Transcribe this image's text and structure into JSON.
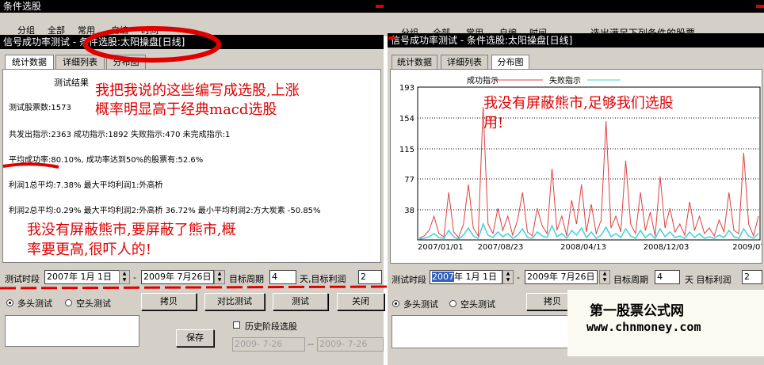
{
  "back_window": {
    "title": "条件选股",
    "tabs": [
      "分组",
      "全部",
      "常用",
      "自编",
      "时间"
    ],
    "caption": "选出满足下列条件的股票"
  },
  "left_window": {
    "title": "信号成功率测试 - 条件选股:太阳操盘[日线]",
    "tabs": [
      "统计数据",
      "详细列表",
      "分布图"
    ],
    "active_tab": 0,
    "heading": "测试结果",
    "lines": [
      "测试股票数:1573",
      "共发出指示:2363 成功指示:1892 失败指示:470 未完成指示:1",
      "平均成功率:80.10%, 成功率达到50%的股票有:52.6%",
      "利润1总平均:7.38% 最大平均利润1:外高桥",
      "利润2总平均:0.29% 最大平均利润2:外高桥     36.72% 最小平均利润2:方大炭素 -50.85%"
    ],
    "annotations": [
      "我把我说的这些编写成选股,上涨",
      "概率明显高于经典macd选股",
      "我没有屏蔽熊市,要屏蔽了熊市,概",
      "率要更高,很吓人的!"
    ],
    "controls": {
      "period_label": "测试时段",
      "start_date": "2007年 1月 1日",
      "dash": "-",
      "end_date": "2009年 7月26日",
      "target_period_label": "目标周期",
      "target_period": "4",
      "days_label": "天,目标利润",
      "target_profit": "2",
      "radio_long": "多头测试",
      "radio_short": "空头测试",
      "buttons": [
        "拷贝",
        "对比测试",
        "测试",
        "关闭"
      ],
      "history_label": "历史阶段选股",
      "save": "保存",
      "hist_start": "2009- 7-26",
      "hist_end": "2009- 7-26"
    }
  },
  "right_window": {
    "title": "信号成功率测试 - 条件选股:太阳操盘[日线]",
    "tabs": [
      "统计数据",
      "详细列表",
      "分布图"
    ],
    "active_tab": 2,
    "annotations": [
      "我没有屏蔽熊市,足够我们选股",
      "用!"
    ],
    "controls": {
      "period_label": "测试时段",
      "start_date_year": "2007",
      "start_date_rest": "年 1月 1日",
      "dash": "-",
      "end_date": "2009年 7月26日",
      "target_period_label": "目标周期",
      "target_period": "4",
      "days_label": "天 目标利润",
      "target_profit": "2",
      "radio_long": "多头测试",
      "radio_short": "空头测试",
      "copy": "拷贝"
    }
  },
  "watermark": {
    "name": "第一股票公式网",
    "url": "www.chnmoney.com"
  },
  "chart_data": {
    "type": "line",
    "legend": [
      "成功指示",
      "失败指示"
    ],
    "legend_placement": "top",
    "yticks": [
      193,
      154,
      115,
      77,
      38
    ],
    "ylim": [
      0,
      193
    ],
    "xticks": [
      "2007/01/01",
      "2007/08/23",
      "2008/04/13",
      "2008/12/03",
      "2009/07"
    ],
    "grid": true,
    "colors": {
      "success": "#e04040",
      "fail": "#40d0e0"
    },
    "series": [
      {
        "name": "成功指示",
        "values": [
          2,
          5,
          12,
          30,
          8,
          4,
          60,
          10,
          3,
          20,
          70,
          15,
          5,
          168,
          20,
          8,
          40,
          12,
          30,
          6,
          25,
          60,
          10,
          5,
          40,
          18,
          8,
          90,
          12,
          30,
          5,
          50,
          20,
          70,
          10,
          45,
          8,
          25,
          150,
          15,
          30,
          10,
          100,
          20,
          8,
          60,
          12,
          35,
          5,
          80,
          15,
          40,
          10,
          20,
          6,
          48,
          12,
          30,
          8,
          15,
          5,
          25,
          10,
          60,
          12,
          8,
          110,
          20,
          5,
          30
        ]
      },
      {
        "name": "失败指示",
        "values": [
          1,
          2,
          4,
          8,
          3,
          2,
          12,
          4,
          1,
          6,
          15,
          5,
          2,
          20,
          6,
          3,
          10,
          4,
          8,
          2,
          6,
          14,
          3,
          2,
          10,
          5,
          3,
          18,
          4,
          8,
          2,
          12,
          6,
          15,
          3,
          10,
          2,
          6,
          16,
          4,
          8,
          3,
          14,
          5,
          2,
          12,
          3,
          8,
          2,
          14,
          4,
          10,
          3,
          5,
          2,
          10,
          3,
          8,
          2,
          4,
          2,
          6,
          3,
          12,
          4,
          2,
          14,
          5,
          2,
          8
        ]
      }
    ]
  }
}
